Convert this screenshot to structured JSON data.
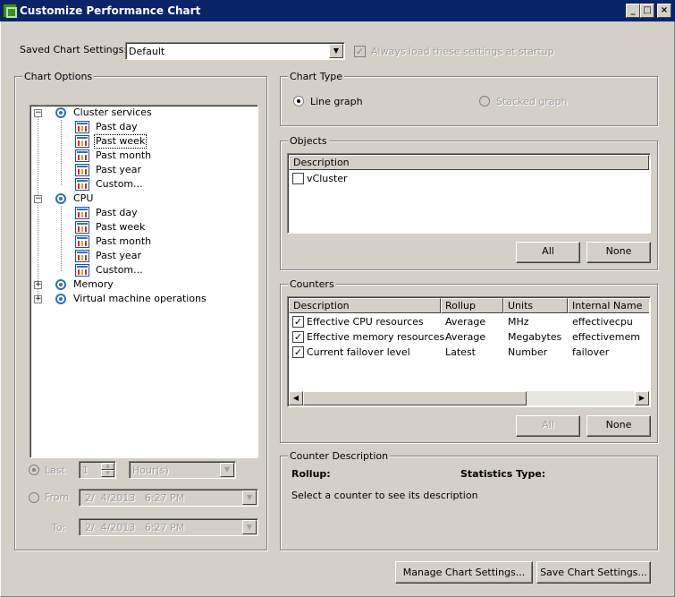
{
  "window": {
    "title": "Customize Performance Chart",
    "minimize": "_",
    "maximize": "□",
    "close": "×"
  },
  "saved_settings": {
    "label": "Saved Chart Settings:",
    "value": "Default",
    "always_load_label": "Always load these settings at startup",
    "always_load_checked": true
  },
  "chart_options": {
    "label": "Chart Options",
    "tree": [
      {
        "label": "Cluster services",
        "expanded": true,
        "children": [
          "Past day",
          "Past week",
          "Past month",
          "Past year",
          "Custom..."
        ],
        "selected_child": "Past week"
      },
      {
        "label": "CPU",
        "expanded": true,
        "children": [
          "Past day",
          "Past week",
          "Past month",
          "Past year",
          "Custom..."
        ]
      },
      {
        "label": "Memory",
        "expanded": false
      },
      {
        "label": "Virtual machine operations",
        "expanded": false
      }
    ],
    "last_label": "Last",
    "last_value": "1",
    "last_unit": "Hour(s)",
    "from_label": "From",
    "from_value": "2/  4/2013   6:27 PM",
    "to_label": "To:",
    "to_value": "2/  4/2013   6:27 PM"
  },
  "chart_type": {
    "label": "Chart Type",
    "line_graph": "Line graph",
    "stacked_graph": "Stacked graph",
    "selected": "Line graph"
  },
  "objects": {
    "label": "Objects",
    "column": "Description",
    "items": [
      {
        "name": "vCluster",
        "checked": false
      }
    ],
    "all_button": "All",
    "none_button": "None"
  },
  "counters": {
    "label": "Counters",
    "columns": [
      "Description",
      "Rollup",
      "Units",
      "Internal Name"
    ],
    "rows": [
      {
        "checked": true,
        "description": "Effective CPU resources",
        "rollup": "Average",
        "units": "MHz",
        "internal": "effectivecpu"
      },
      {
        "checked": true,
        "description": "Effective memory resources",
        "rollup": "Average",
        "units": "Megabytes",
        "internal": "effectivemem"
      },
      {
        "checked": true,
        "description": "Current failover level",
        "rollup": "Latest",
        "units": "Number",
        "internal": "failover"
      }
    ],
    "all_button": "All",
    "none_button": "None"
  },
  "counter_description": {
    "label": "Counter Description",
    "rollup_label": "Rollup:",
    "stats_label": "Statistics Type:",
    "hint": "Select a counter to see its description"
  },
  "footer": {
    "manage_button": "Manage Chart Settings...",
    "save_button": "Save Chart Settings..."
  }
}
